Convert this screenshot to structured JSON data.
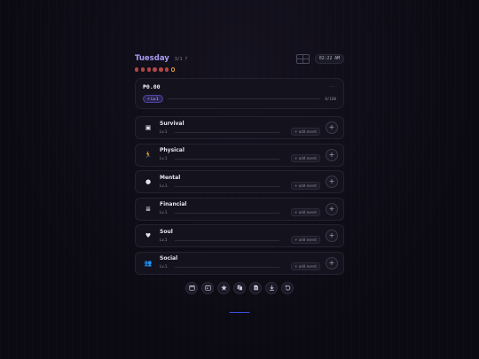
{
  "header": {
    "day": "Tuesday",
    "date": "3/1 ?",
    "time": "02:22 AM"
  },
  "dots": {
    "total": 7,
    "current_index": 6,
    "colors": {
      "past": "#b04646",
      "current": "#e09a3a"
    }
  },
  "money": {
    "amount": "₱0.00",
    "menu_icon": "···",
    "level_badge": "⚡ Lv.1",
    "xp_text": "0/100",
    "xp_progress": 0
  },
  "categories": [
    {
      "name": "Survival",
      "level": "Lv.1",
      "add_label": "+ add event",
      "icon": "▣",
      "icon_name": "briefcase-icon",
      "progress": 0
    },
    {
      "name": "Physical",
      "level": "Lv.1",
      "add_label": "+ add event",
      "icon": "🏃",
      "icon_name": "running-icon",
      "progress": 0
    },
    {
      "name": "Mental",
      "level": "Lv.1",
      "add_label": "+ add event",
      "icon": "●",
      "icon_name": "brain-icon",
      "progress": 0
    },
    {
      "name": "Financial",
      "level": "Lv.1",
      "add_label": "+ add event",
      "icon": "≣",
      "icon_name": "coins-icon",
      "progress": 0
    },
    {
      "name": "Soul",
      "level": "Lv.1",
      "add_label": "+ add event",
      "icon": "♥",
      "icon_name": "heart-icon",
      "progress": 0
    },
    {
      "name": "Social",
      "level": "Lv.1",
      "add_label": "+ add event",
      "icon": "👥",
      "icon_name": "people-icon",
      "progress": 0
    }
  ],
  "plus_label": "+",
  "toolbar": [
    "calendar-icon",
    "calendar-check-icon",
    "star-icon",
    "copy-icon",
    "document-icon",
    "download-icon",
    "undo-icon"
  ],
  "colors": {
    "accent": "#a99cf0",
    "link": "#3b4fd8"
  }
}
